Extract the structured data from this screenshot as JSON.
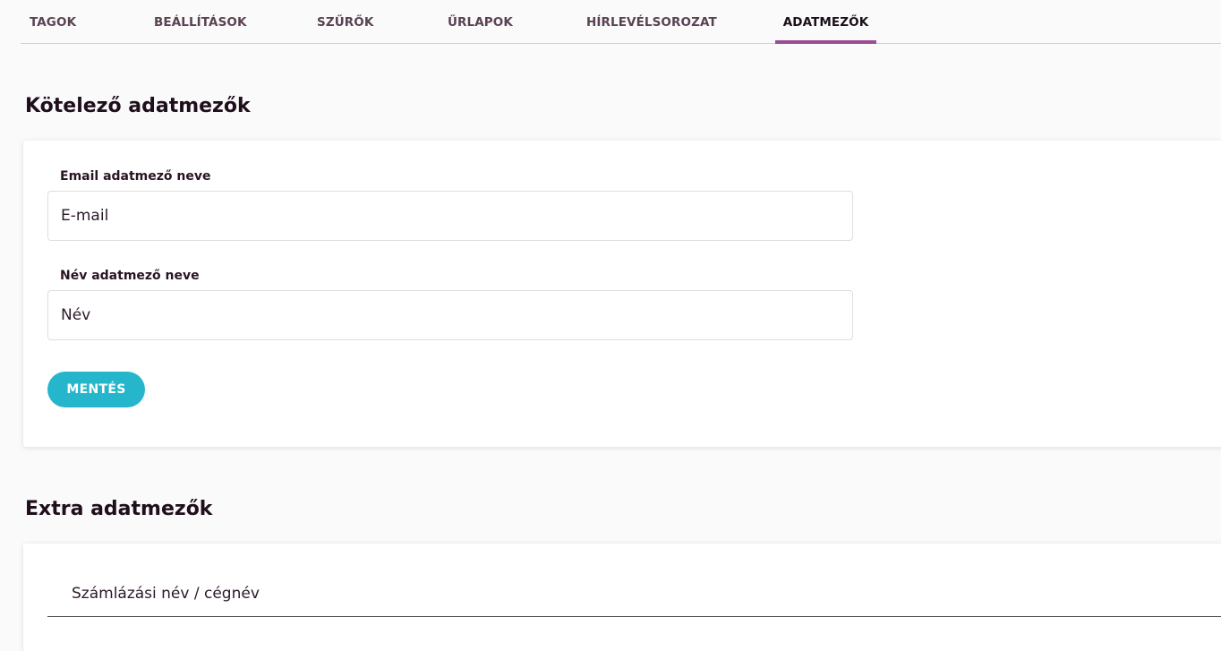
{
  "tabs": [
    {
      "label": "TAGOK"
    },
    {
      "label": "BEÁLLÍTÁSOK"
    },
    {
      "label": "SZŰRŐK"
    },
    {
      "label": "ŰRLAPOK"
    },
    {
      "label": "HÍRLEVÉLSOROZAT"
    },
    {
      "label": "ADATMEZŐK"
    }
  ],
  "active_tab": "ADATMEZŐK",
  "required_section": {
    "title": "Kötelező adatmezők",
    "email_field": {
      "label": "Email adatmező neve",
      "value": "E-mail"
    },
    "name_field": {
      "label": "Név adatmező neve",
      "value": "Név"
    },
    "save_label": "MENTÉS"
  },
  "extra_section": {
    "title": "Extra adatmezők",
    "items": [
      {
        "label": "Számlázási név / cégnév"
      }
    ]
  },
  "colors": {
    "accent": "#9b4c96",
    "button": "#26b6cc"
  }
}
